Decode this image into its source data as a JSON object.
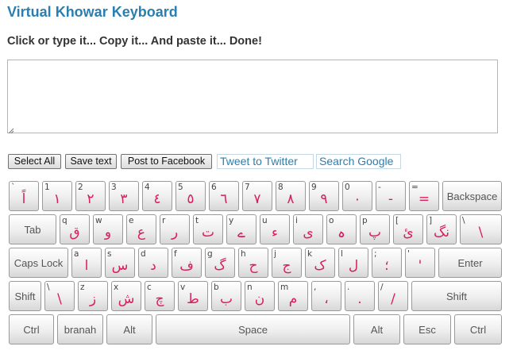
{
  "header": {
    "title": "Virtual Khowar Keyboard",
    "subtitle": "Click or type it... Copy it... And paste it... Done!"
  },
  "editor": {
    "value": ""
  },
  "toolbar": {
    "select_all": "Select All",
    "save_text": "Save text",
    "post_facebook": "Post to Facebook",
    "tweet_twitter": "Tweet to Twitter",
    "search_google": "Search Google"
  },
  "keyboard": {
    "row1": [
      {
        "top": "`",
        "main": "اً"
      },
      {
        "top": "1",
        "main": "١"
      },
      {
        "top": "2",
        "main": "٢"
      },
      {
        "top": "3",
        "main": "٣"
      },
      {
        "top": "4",
        "main": "٤"
      },
      {
        "top": "5",
        "main": "٥"
      },
      {
        "top": "6",
        "main": "٦"
      },
      {
        "top": "7",
        "main": "٧"
      },
      {
        "top": "8",
        "main": "٨"
      },
      {
        "top": "9",
        "main": "٩"
      },
      {
        "top": "0",
        "main": "٠"
      },
      {
        "top": "-",
        "main": "-"
      },
      {
        "top": "=",
        "main": "="
      }
    ],
    "backspace": "Backspace",
    "tab": "Tab",
    "row2": [
      {
        "top": "q",
        "main": "ق"
      },
      {
        "top": "w",
        "main": "و"
      },
      {
        "top": "e",
        "main": "ع"
      },
      {
        "top": "r",
        "main": "ر"
      },
      {
        "top": "t",
        "main": "ت"
      },
      {
        "top": "y",
        "main": "ے"
      },
      {
        "top": "u",
        "main": "ء"
      },
      {
        "top": "i",
        "main": "ی"
      },
      {
        "top": "o",
        "main": "ہ"
      },
      {
        "top": "p",
        "main": "پ"
      },
      {
        "top": "[",
        "main": "ئ"
      },
      {
        "top": "]",
        "main": "نگ"
      },
      {
        "top": "\\",
        "main": "\\"
      }
    ],
    "capslock": "Caps Lock",
    "row3": [
      {
        "top": "a",
        "main": "ا"
      },
      {
        "top": "s",
        "main": "س"
      },
      {
        "top": "d",
        "main": "د"
      },
      {
        "top": "f",
        "main": "ف"
      },
      {
        "top": "g",
        "main": "گ"
      },
      {
        "top": "h",
        "main": "ح"
      },
      {
        "top": "j",
        "main": "ج"
      },
      {
        "top": "k",
        "main": "ک"
      },
      {
        "top": "l",
        "main": "ل"
      },
      {
        "top": ";",
        "main": "؛"
      },
      {
        "top": "'",
        "main": "'"
      }
    ],
    "enter": "Enter",
    "shift_left": "Shift",
    "row4": [
      {
        "top": "\\",
        "main": "\\"
      },
      {
        "top": "z",
        "main": "ز"
      },
      {
        "top": "x",
        "main": "ش"
      },
      {
        "top": "c",
        "main": "چ"
      },
      {
        "top": "v",
        "main": "ط"
      },
      {
        "top": "b",
        "main": "ب"
      },
      {
        "top": "n",
        "main": "ن"
      },
      {
        "top": "m",
        "main": "م"
      },
      {
        "top": ",",
        "main": "،"
      },
      {
        "top": ".",
        "main": "."
      },
      {
        "top": "/",
        "main": "/"
      }
    ],
    "shift_right": "Shift",
    "row5": {
      "ctrl_left": "Ctrl",
      "branah": "branah",
      "alt_left": "Alt",
      "space": "Space",
      "alt_right": "Alt",
      "esc": "Esc",
      "ctrl_right": "Ctrl"
    }
  }
}
